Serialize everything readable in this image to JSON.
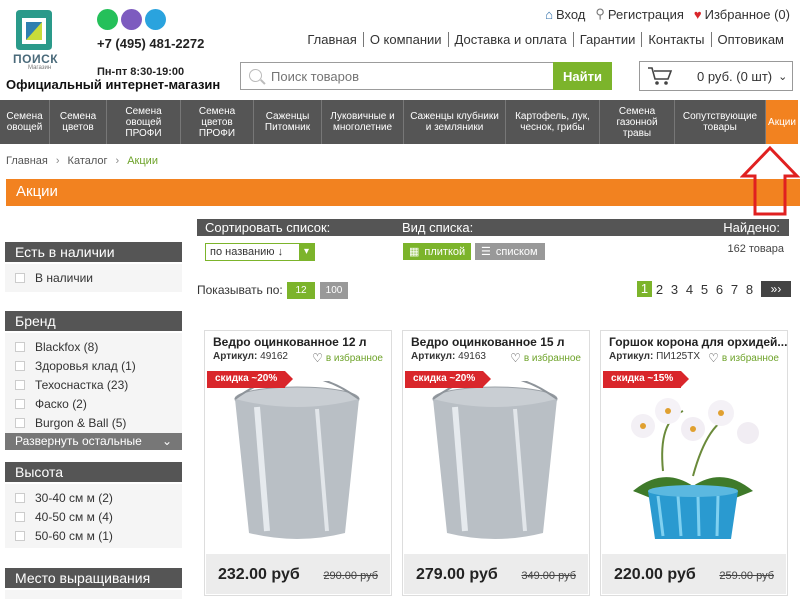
{
  "header": {
    "logo_text": "ПОИСК",
    "logo_sub": "Магазин",
    "phone": "+7 (495) 481-2272",
    "hours": "Пн-пт 8:30-19:00",
    "tagline": "Официальный интернет-магазин",
    "login": "Вход",
    "register": "Регистрация",
    "favorites": "Избранное (0)",
    "nav": [
      "Главная",
      "О компании",
      "Доставка и оплата",
      "Гарантии",
      "Контакты",
      "Оптовикам"
    ],
    "search_placeholder": "Поиск товаров",
    "search_button": "Найти",
    "cart": "0 руб. (0 шт)"
  },
  "categories": [
    "Семена овощей",
    "Семена цветов",
    "Семена овощей ПРОФИ",
    "Семена цветов ПРОФИ",
    "Саженцы Питомник",
    "Луковичные и многолетние",
    "Саженцы клубники и земляники",
    "Картофель, лук, чеснок, грибы",
    "Семена газонной травы",
    "Сопутствующие товары",
    "Акции"
  ],
  "breadcrumb": [
    "Главная",
    "Каталог",
    "Акции"
  ],
  "page_title": "Акции",
  "filters": {
    "availability": {
      "title": "Есть в наличии",
      "items": [
        "В наличии"
      ]
    },
    "brand": {
      "title": "Бренд",
      "items": [
        "Blackfox (8)",
        "Здоровья клад (1)",
        "Техоснастка (23)",
        "Фаско (2)",
        "Burgon & Ball (5)"
      ],
      "expand": "Развернуть остальные"
    },
    "height": {
      "title": "Высота",
      "items": [
        "30-40 см м (2)",
        "40-50 см м (4)",
        "50-60 см м (1)"
      ]
    },
    "place": {
      "title": "Место выращивания"
    }
  },
  "toolbar": {
    "sort_label": "Сортировать список:",
    "view_label": "Вид списка:",
    "found_label": "Найдено:",
    "sort_value": "по названию ↓",
    "view_grid": "плиткой",
    "view_list": "списком",
    "found_count": "162 товара",
    "show_label": "Показывать по:",
    "per_page": [
      "12",
      "100"
    ],
    "pages": [
      "1",
      "2",
      "3",
      "4",
      "5",
      "6",
      "7",
      "8"
    ]
  },
  "products": [
    {
      "title": "Ведро оцинкованное 12 л",
      "art_label": "Артикул:",
      "art": "49162",
      "fav": "в избранное",
      "discount": "скидка ~20%",
      "price": "232.00 руб",
      "old_price": "290.00 руб"
    },
    {
      "title": "Ведро оцинкованное 15 л",
      "art_label": "Артикул:",
      "art": "49163",
      "fav": "в избранное",
      "discount": "скидка ~20%",
      "price": "279.00 руб",
      "old_price": "349.00 руб"
    },
    {
      "title": "Горшок корона для орхидей...",
      "art_label": "Артикул:",
      "art": "ПИ125ТХ",
      "fav": "в избранное",
      "discount": "скидка ~15%",
      "price": "220.00 руб",
      "old_price": "259.00 руб"
    }
  ],
  "colors": {
    "accent": "#f28220",
    "green": "#7cb42b",
    "dark": "#555555",
    "sale": "#d9262b"
  }
}
